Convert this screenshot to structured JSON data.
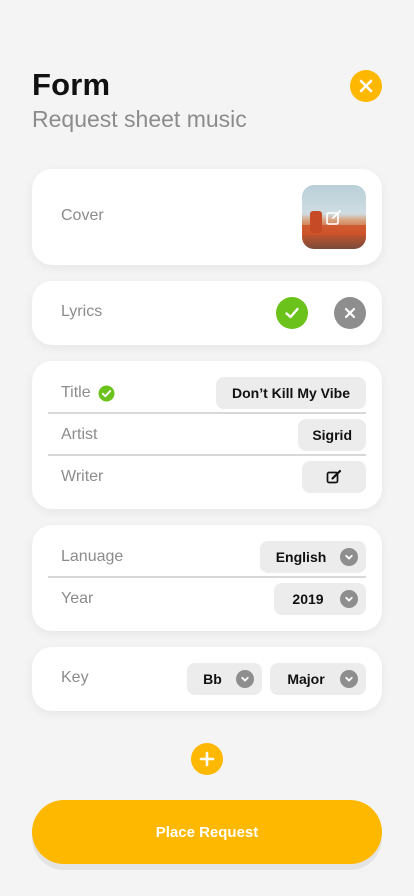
{
  "header": {
    "title": "Form",
    "subtitle": "Request sheet music"
  },
  "colors": {
    "accent": "#ffb800",
    "success": "#6bc21a",
    "muted": "#8e8e8e",
    "chip_bg": "#ececec"
  },
  "cover": {
    "label": "Cover",
    "edit_icon": "edit-image-icon"
  },
  "lyrics": {
    "label": "Lyrics",
    "confirm_icon": "check-icon",
    "remove_icon": "x-icon"
  },
  "details": {
    "title_label": "Title",
    "title_value": "Don’t Kill My Vibe",
    "artist_label": "Artist",
    "artist_value": "Sigrid",
    "writer_label": "Writer",
    "writer_icon": "pencil-square-icon"
  },
  "meta": {
    "language_label": "Lanuage",
    "language_value": "English",
    "year_label": "Year",
    "year_value": "2019"
  },
  "key": {
    "label": "Key",
    "note_value": "Bb",
    "mode_value": "Major"
  },
  "actions": {
    "add_icon": "plus-icon",
    "submit_label": "Place Request"
  }
}
